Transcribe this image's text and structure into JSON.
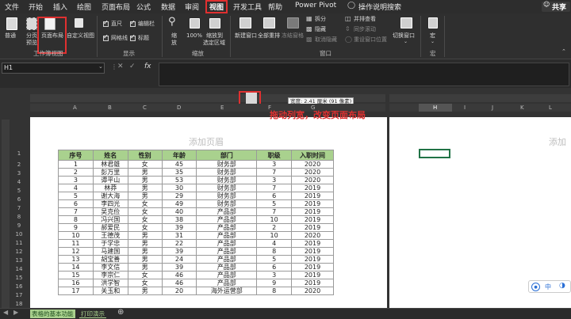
{
  "ribbon_tabs": [
    "文件",
    "开始",
    "插入",
    "绘图",
    "页面布局",
    "公式",
    "数据",
    "审阅",
    "视图",
    "开发工具",
    "帮助",
    "Power Pivot"
  ],
  "active_tab": "视图",
  "search_label": "操作说明搜索",
  "share_label": "共享",
  "workbook_views": {
    "normal": "普通",
    "page_break_1": "分页",
    "page_break_2": "预览",
    "page_layout": "页面布局",
    "custom_views": "自定义视图",
    "group": "工作簿视图"
  },
  "show": {
    "ruler": "直尺",
    "formula_bar": "编辑栏",
    "gridlines": "网格线",
    "headings": "标题",
    "group": "显示"
  },
  "zoom": {
    "zoom": "缩",
    "zoom2": "放",
    "zoom100": "100%",
    "to_selection_1": "缩放到",
    "to_selection_2": "选定区域",
    "group": "缩放"
  },
  "window": {
    "new_window": "新建窗口",
    "arrange_all": "全部重排",
    "freeze_panes": "冻结窗格",
    "split": "拆分",
    "hide": "隐藏",
    "unhide": "取消隐藏",
    "side_by_side": "并排查看",
    "sync_scroll": "同步滚动",
    "reset_position": "重设窗口位置",
    "switch_windows": "切换窗口",
    "group": "窗口"
  },
  "macros": {
    "label": "宏",
    "group": "宏"
  },
  "name_box": "H1",
  "fx_label": "fx",
  "header_placeholder": "添加页眉",
  "header_placeholder_right": "添加",
  "width_tooltip": "宽度: 2.41 厘米 (91 像素)",
  "annotation": "拖动列宽，改变页面布局",
  "columns_left": [
    "A",
    "B",
    "C",
    "D",
    "E",
    "F",
    "G"
  ],
  "columns_right": [
    "H",
    "I",
    "J",
    "K",
    "L"
  ],
  "table": {
    "headers": [
      "序号",
      "姓名",
      "性别",
      "年龄",
      "部门",
      "职级",
      "入职时间"
    ],
    "rows": [
      [
        "1",
        "林君雄",
        "女",
        "45",
        "财务部",
        "3",
        "2020"
      ],
      [
        "2",
        "彭万里",
        "男",
        "35",
        "财务部",
        "7",
        "2020"
      ],
      [
        "3",
        "谭平山",
        "男",
        "53",
        "财务部",
        "3",
        "2020"
      ],
      [
        "4",
        "林莽",
        "男",
        "30",
        "财务部",
        "7",
        "2019"
      ],
      [
        "5",
        "谢大海",
        "男",
        "29",
        "财务部",
        "6",
        "2019"
      ],
      [
        "6",
        "李四光",
        "女",
        "49",
        "财务部",
        "5",
        "2019"
      ],
      [
        "7",
        "吴克俭",
        "女",
        "40",
        "产品部",
        "7",
        "2019"
      ],
      [
        "8",
        "冯兴国",
        "女",
        "38",
        "产品部",
        "10",
        "2019"
      ],
      [
        "9",
        "郝爱民",
        "女",
        "39",
        "产品部",
        "2",
        "2019"
      ],
      [
        "10",
        "王德茂",
        "男",
        "31",
        "产品部",
        "10",
        "2020"
      ],
      [
        "11",
        "于学忠",
        "男",
        "22",
        "产品部",
        "4",
        "2019"
      ],
      [
        "12",
        "马建国",
        "男",
        "39",
        "产品部",
        "8",
        "2019"
      ],
      [
        "13",
        "胡宝善",
        "男",
        "24",
        "产品部",
        "5",
        "2019"
      ],
      [
        "14",
        "李文信",
        "男",
        "39",
        "产品部",
        "6",
        "2019"
      ],
      [
        "15",
        "李宗仁",
        "女",
        "46",
        "产品部",
        "3",
        "2019"
      ],
      [
        "16",
        "洪学智",
        "女",
        "46",
        "产品部",
        "9",
        "2019"
      ],
      [
        "17",
        "关玉和",
        "男",
        "20",
        "海外运营部",
        "8",
        "2020"
      ]
    ]
  },
  "sheet_tabs": [
    "表格的基本功能",
    "打印演示"
  ],
  "ime": {
    "zh": "中"
  },
  "colors": {
    "header_green": "#a9d18e",
    "red": "#e03030",
    "sheet_tab_active": "#a9d18e"
  }
}
